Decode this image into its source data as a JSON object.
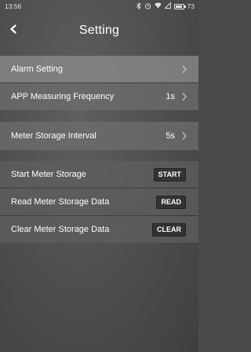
{
  "status_bar": {
    "time": "13:56",
    "icons": [
      "bluetooth-icon",
      "alarm-icon",
      "wifi-icon",
      "signal-icon"
    ],
    "battery": "73"
  },
  "header": {
    "title": "Setting"
  },
  "settings": {
    "alarm_setting": {
      "label": "Alarm Setting"
    },
    "app_frequency": {
      "label": "APP Measuring Frequency",
      "value": "1s"
    },
    "storage_interval": {
      "label": "Meter Storage Interval",
      "value": "5s"
    },
    "start_storage": {
      "label": "Start Meter Storage",
      "button": "START"
    },
    "read_storage": {
      "label": "Read Meter Storage Data",
      "button": "READ"
    },
    "clear_storage": {
      "label": "Clear Meter Storage Data",
      "button": "CLEAR"
    }
  }
}
